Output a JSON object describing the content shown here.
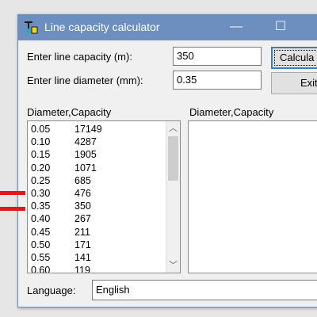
{
  "window": {
    "title": "Line capacity calculator",
    "icon": "app-icon",
    "minimize_glyph": "—",
    "maximize_glyph": "☐"
  },
  "form": {
    "capacity_label": "Enter line capacity (m):",
    "capacity_value": "350",
    "diameter_label": "Enter line diameter (mm):",
    "diameter_value": "0.35"
  },
  "buttons": {
    "calculate_label": "Calcula",
    "exit_label": "Exit"
  },
  "left_list": {
    "header": "Diameter,Capacity",
    "rows": [
      {
        "diameter": "0.05",
        "capacity": "17149"
      },
      {
        "diameter": "0.10",
        "capacity": "4287"
      },
      {
        "diameter": "0.15",
        "capacity": "1905"
      },
      {
        "diameter": "0.20",
        "capacity": "1071"
      },
      {
        "diameter": "0.25",
        "capacity": "685"
      },
      {
        "diameter": "0.30",
        "capacity": "476"
      },
      {
        "diameter": "0.35",
        "capacity": "350"
      },
      {
        "diameter": "0.40",
        "capacity": "267"
      },
      {
        "diameter": "0.45",
        "capacity": "211"
      },
      {
        "diameter": "0.50",
        "capacity": "171"
      },
      {
        "diameter": "0.55",
        "capacity": "141"
      },
      {
        "diameter": "0.60",
        "capacity": "119"
      }
    ]
  },
  "right_list": {
    "header": "Diameter,Capacity"
  },
  "language": {
    "label": "Language:",
    "value": "English"
  },
  "colors": {
    "titlebar": "#6d8fbf",
    "marker": "#e0191f"
  }
}
